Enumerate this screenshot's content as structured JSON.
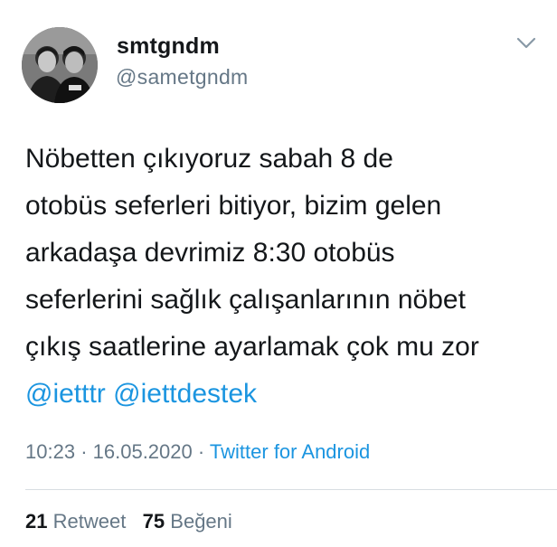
{
  "author": {
    "display_name": "smtgndm",
    "handle": "@sametgndm"
  },
  "tweet": {
    "lines": [
      "Nöbetten çıkıyoruz sabah 8 de",
      "otobüs seferleri bitiyor, bizim gelen",
      "arkadaşa devrimiz 8:30 otobüs",
      "seferlerini sağlık çalışanlarının nöbet",
      "çıkış saatlerine ayarlamak çok mu zor"
    ],
    "mentions": [
      "@ietttr",
      "@iettdestek"
    ]
  },
  "meta": {
    "time": "10:23",
    "date": "16.05.2020",
    "separator": "·",
    "source": "Twitter for Android"
  },
  "stats": {
    "retweet_count": "21",
    "retweet_label": "Retweet",
    "like_count": "75",
    "like_label": "Beğeni"
  },
  "icons": {
    "menu": "chevron-down-icon"
  },
  "colors": {
    "link": "#1b95e0",
    "secondary": "#657786",
    "text": "#14171a"
  }
}
